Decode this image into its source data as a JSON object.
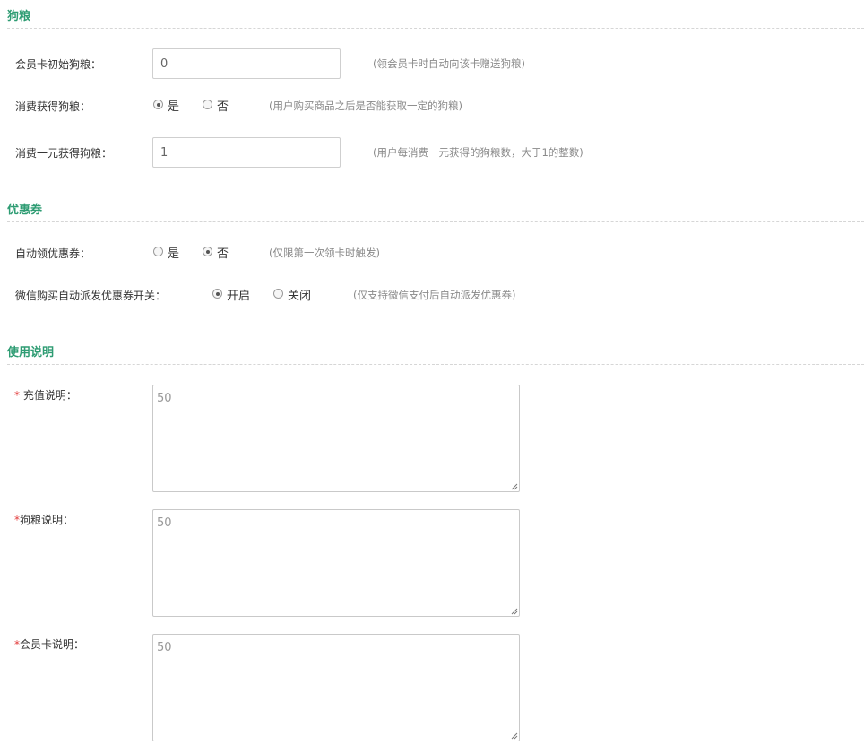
{
  "sections": {
    "dog_food": {
      "title": "狗粮",
      "initial": {
        "label": "会员卡初始狗粮：",
        "value": "0",
        "hint": "(领会员卡时自动向该卡赠送狗粮)"
      },
      "earn": {
        "label": "消费获得狗粮：",
        "yes": "是",
        "no": "否",
        "selected": "yes",
        "hint": "(用户购买商品之后是否能获取一定的狗粮)"
      },
      "per_yuan": {
        "label": "消费一元获得狗粮：",
        "value": "1",
        "hint": "(用户每消费一元获得的狗粮数，大于1的整数)"
      }
    },
    "coupon": {
      "title": "优惠券",
      "auto": {
        "label": "自动领优惠券：",
        "yes": "是",
        "no": "否",
        "selected": "no",
        "hint": "(仅限第一次领卡时触发)"
      },
      "wechat": {
        "label": "微信购买自动派发优惠券开关：",
        "on": "开启",
        "off": "关闭",
        "selected": "on",
        "hint": "(仅支持微信支付后自动派发优惠券)"
      }
    },
    "usage": {
      "title": "使用说明",
      "required_mark": "*",
      "recharge": {
        "label": " 充值说明：",
        "value": "50"
      },
      "dog_food": {
        "label": "狗粮说明：",
        "value": "50"
      },
      "member_card": {
        "label": "会员卡说明：",
        "value": "50"
      }
    }
  },
  "colors": {
    "accent": "#2e9c73",
    "required": "#e23b3b",
    "hint": "#8a8a8a"
  }
}
